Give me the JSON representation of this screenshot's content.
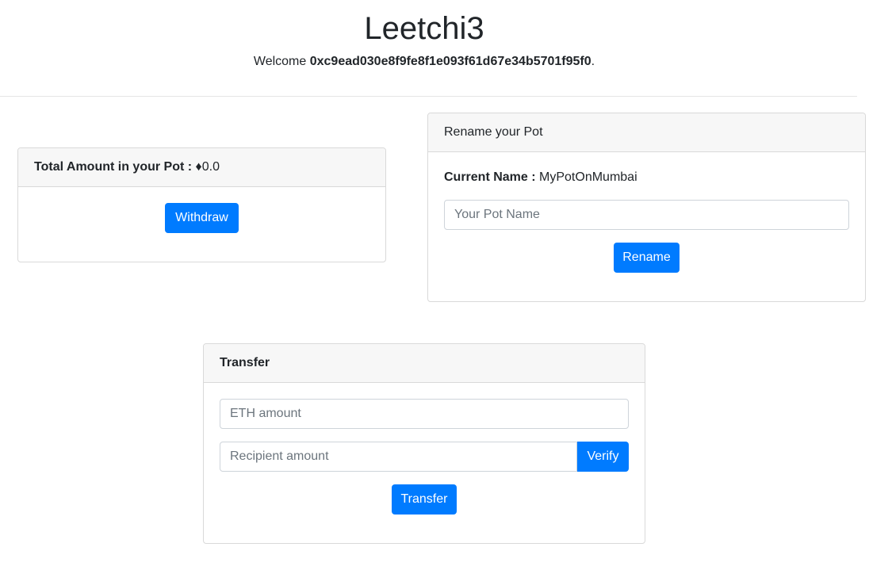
{
  "header": {
    "title": "Leetchi3",
    "welcome_prefix": "Welcome ",
    "address": "0xc9ead030e8f9fe8f1e093f61d67e34b5701f95f0",
    "welcome_suffix": "."
  },
  "pot": {
    "label": "Total Amount in your Pot :",
    "eth_symbol": "♦",
    "amount": "0.0",
    "withdraw_label": "Withdraw"
  },
  "rename": {
    "header": "Rename your Pot",
    "current_name_label": "Current Name :",
    "current_name_value": "MyPotOnMumbai",
    "name_input_placeholder": "Your Pot Name",
    "rename_label": "Rename"
  },
  "transfer": {
    "header": "Transfer",
    "eth_amount_placeholder": "ETH amount",
    "recipient_placeholder": "Recipient amount",
    "verify_label": "Verify",
    "transfer_label": "Transfer"
  },
  "colors": {
    "primary": "#007bff",
    "card_header_bg": "#f7f7f7",
    "border": "#d9d9d9"
  }
}
